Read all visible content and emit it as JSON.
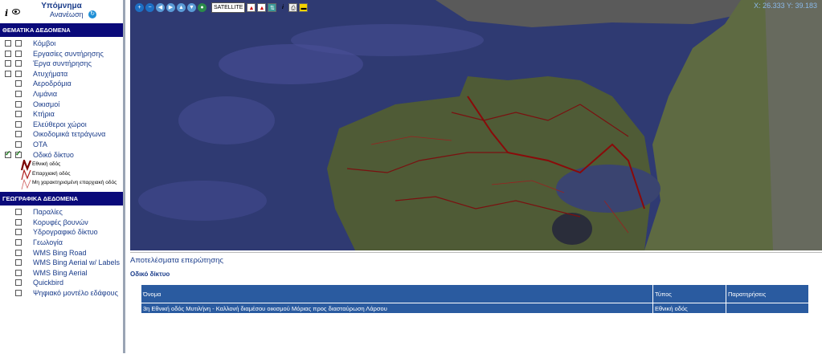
{
  "legend": {
    "title": "Υπόμνημα",
    "refresh_label": "Ανανέωση"
  },
  "thematic": {
    "header": "ΘΕΜΑΤΙΚΑ ΔΕΔΟΜΕΝΑ",
    "layers": [
      {
        "label": "Κόμβοι",
        "checked": false
      },
      {
        "label": "Εργασίες συντήρησης",
        "checked": false
      },
      {
        "label": "Έργα συντήρησης",
        "checked": false
      },
      {
        "label": "Ατυχήματα",
        "checked": false
      },
      {
        "label": "Αεροδρόμια",
        "checked": false
      },
      {
        "label": "Λιμάνια",
        "checked": false
      },
      {
        "label": "Οικισμοί",
        "checked": false
      },
      {
        "label": "Κτήρια",
        "checked": false
      },
      {
        "label": "Ελεύθεροι χώροι",
        "checked": false
      },
      {
        "label": "Οικοδομικά τετράγωνα",
        "checked": false
      },
      {
        "label": "ΟΤΑ",
        "checked": false
      },
      {
        "label": "Οδικό δίκτυο",
        "checked": true
      }
    ],
    "road_legend": [
      {
        "label": "Εθνική οδός"
      },
      {
        "label": "Επαρχιακή οδός"
      },
      {
        "label": "Μη χαρακτηρισμένη επαρχιακή οδός"
      }
    ]
  },
  "geographic": {
    "header": "ΓΕΩΓΡΑΦΙΚΑ ΔΕΔΟΜΕΝΑ",
    "layers": [
      {
        "label": "Παραλίες"
      },
      {
        "label": "Κορυφές βουνών"
      },
      {
        "label": "Υδρογραφικό δίκτυο"
      },
      {
        "label": "Γεωλογία"
      },
      {
        "label": "WMS Bing Road"
      },
      {
        "label": "WMS Bing Aerial w/ Labels"
      },
      {
        "label": "WMS Bing Aerial"
      },
      {
        "label": "Quickbird"
      },
      {
        "label": "Ψηφιακό μοντέλο εδάφους"
      }
    ]
  },
  "map": {
    "basemap_select": "SATELLITE",
    "coords": "X: 26.333 Y: 39.183"
  },
  "results": {
    "title": "Αποτελέσματα επερώτησης",
    "subtitle": "Οδικό δίκτυο",
    "columns": [
      "Όνομα",
      "Τύπος",
      "Παρατηρήσεις"
    ],
    "rows": [
      [
        "3η Εθνική οδός Μυτιλήνη - Καλλονή διαμέσου οικισμού Μόριας προς διασταύρωση Λάρσου",
        "Εθνική οδός",
        ""
      ]
    ]
  }
}
